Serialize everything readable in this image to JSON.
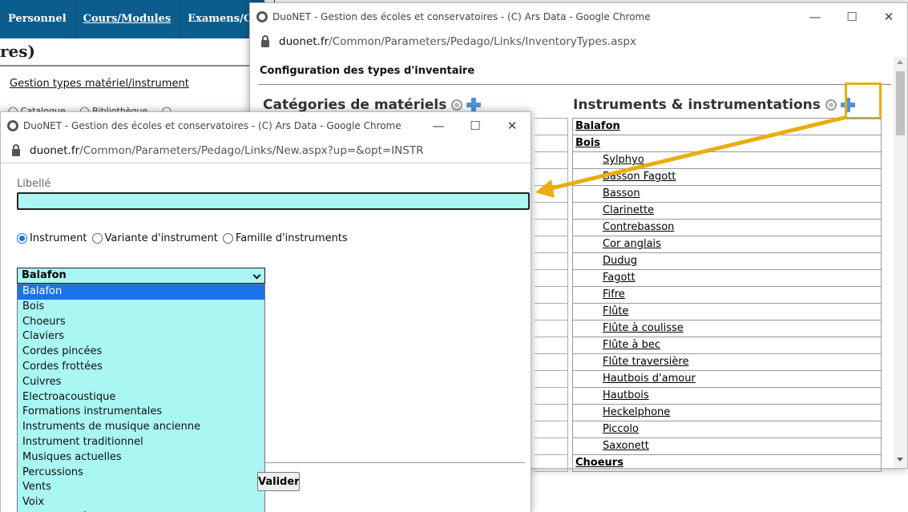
{
  "background_page": {
    "nav": [
      "Personnel",
      "Cours/Modules",
      "Examens/Con"
    ],
    "title": "res)",
    "link": "Gestion types matériel/instrument",
    "radios_text": "◯ Catalogue ... ◯ Bibliothèque ... ◯"
  },
  "main_window": {
    "title": "DuoNET - Gestion des écoles et conservatoires - (C) Ars Data - Google Chrome",
    "url_host": "duonet.fr",
    "url_path": "/Common/Parameters/Pedago/Links/InventoryTypes.aspx",
    "controls": {
      "minimize": "—",
      "maximize": "☐",
      "close": "✕"
    },
    "heading": "Configuration des types d'inventaire",
    "categories_heading": "Catégories de matériels",
    "instruments_heading": "Instruments & instrumentations",
    "instruments": [
      {
        "label": "Balafon",
        "level": "group"
      },
      {
        "label": "Bois",
        "level": "group"
      },
      {
        "label": "Sylphyo",
        "level": "child"
      },
      {
        "label": "Basson Fagott",
        "level": "child"
      },
      {
        "label": "Basson",
        "level": "child"
      },
      {
        "label": "Clarinette",
        "level": "child"
      },
      {
        "label": "Contrebasson",
        "level": "child"
      },
      {
        "label": "Cor anglais",
        "level": "child"
      },
      {
        "label": "Dudug",
        "level": "child"
      },
      {
        "label": "Fagott",
        "level": "child"
      },
      {
        "label": "Fifre",
        "level": "child"
      },
      {
        "label": "Flûte",
        "level": "child"
      },
      {
        "label": "Flûte à coulisse",
        "level": "child"
      },
      {
        "label": "Flûte à bec",
        "level": "child"
      },
      {
        "label": "Flûte traversière",
        "level": "child"
      },
      {
        "label": "Hautbois d'amour",
        "level": "child"
      },
      {
        "label": "Hautbois",
        "level": "child"
      },
      {
        "label": "Heckelphone",
        "level": "child"
      },
      {
        "label": "Piccolo",
        "level": "child"
      },
      {
        "label": "Saxonett",
        "level": "child"
      },
      {
        "label": "Choeurs",
        "level": "group"
      }
    ]
  },
  "popup_window": {
    "title": "DuoNET - Gestion des écoles et conservatoires - (C) Ars Data - Google Chrome",
    "url_host": "duonet.fr",
    "url_path": "/Common/Parameters/Pedago/Links/New.aspx?up=&opt=INSTR",
    "controls": {
      "minimize": "—",
      "maximize": "☐",
      "close": "✕"
    },
    "libelle_label": "Libellé",
    "libelle_value": "",
    "radio_options": [
      {
        "label": "Instrument",
        "checked": true
      },
      {
        "label": "Variante d'instrument",
        "checked": false
      },
      {
        "label": "Famille d'instruments",
        "checked": false
      }
    ],
    "select_value": "Balafon",
    "dropdown_options": [
      "Balafon",
      "Bois",
      "Choeurs",
      "Claviers",
      "Cordes pincées",
      "Cordes frottées",
      "Cuivres",
      "Electroacoustique",
      "Formations instrumentales",
      "Instruments de musique ancienne",
      "Instrument traditionnel",
      "Musiques actuelles",
      "Percussions",
      "Vents",
      "Voix",
      "Instrument à percussion"
    ],
    "valider_label": "Valider"
  },
  "colors": {
    "nav_bg": "#0b5d8e",
    "field_bg": "#aaf6f3",
    "selection": "#1a73e8",
    "highlight": "#e9ad10",
    "add_icon": "#4f92d6"
  },
  "icons": [
    "settings-icon",
    "add-icon",
    "lock-icon",
    "chrome-icon",
    "chevron-down-icon"
  ]
}
